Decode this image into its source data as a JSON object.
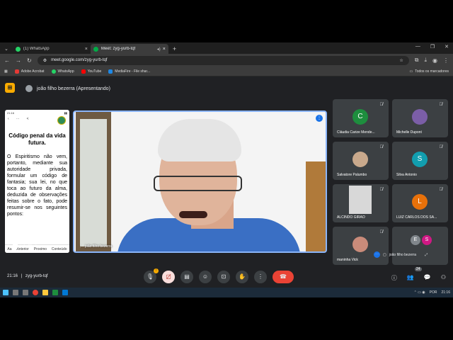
{
  "browser": {
    "tabs": [
      {
        "label": "(1) WhatsApp",
        "icon": "whatsapp-icon",
        "color": "#25d366"
      },
      {
        "label": "Meet: zyg-yurb-tqf",
        "icon": "meet-icon",
        "color": "#00ac47"
      }
    ],
    "url": "meet.google.com/zyg-yurb-tqf",
    "bookmarks": [
      {
        "label": "Adobe Acrobat",
        "color": "#e53935"
      },
      {
        "label": "WhatsApp",
        "color": "#25d366"
      },
      {
        "label": "YouTube",
        "color": "#ff0000"
      },
      {
        "label": "MediaFire - File shar...",
        "color": "#1e88e5"
      }
    ],
    "all_bookmarks": "Todos os marcadores"
  },
  "meet": {
    "presenting_label": "joão filho bezerra (Apresentando)",
    "phone": {
      "status_time": "21:16",
      "title": "Código penal da vida futura.",
      "body": "O Espiritismo não vem, portanto, mediante sua autoridade privada, formular um código de fantasia; sua lei, no que toca ao futuro da alma, deduzida de observações feitas sobre o fato, pode resumir-se nos seguintes pontos:",
      "bottom_items": [
        "Aa",
        "Anterior",
        "Proximo",
        "Conteúdo"
      ],
      "logo_caption": "Bonsagens"
    },
    "screen_label": "joão filho bezerra",
    "camera_label": "joão filho bezerra",
    "participants": [
      {
        "name": "Cláudia Carize Mende...",
        "initial": "C",
        "color": "#1e8e3e"
      },
      {
        "name": "Michelle Dupont",
        "initial": "",
        "color": "#7b5ea7"
      },
      {
        "name": "Salvatore Palumbo",
        "initial": "",
        "color": "#c9a98c"
      },
      {
        "name": "Silva Antonio",
        "initial": "S",
        "color": "#129eaf"
      },
      {
        "name": "ALCINDO GIRÃO",
        "initial": "",
        "color": "#d8d8d8"
      },
      {
        "name": "LUIZ CARLOS DOS SA...",
        "initial": "L",
        "color": "#e8710a"
      },
      {
        "name": "maninha Vick",
        "initial": "",
        "color": "#c98b7a"
      },
      {
        "name": "joão filho bezerra",
        "initials": [
          "E",
          "S"
        ],
        "colors": [
          "#80868b",
          "#d01884"
        ]
      }
    ],
    "time": "21:16",
    "meeting_code": "zyg-yurb-tqf",
    "participant_count": "24",
    "accent": "#8ab4f8",
    "end_call_color": "#ea4335"
  },
  "taskbar": {
    "lang": "POR",
    "time": "21:16"
  }
}
